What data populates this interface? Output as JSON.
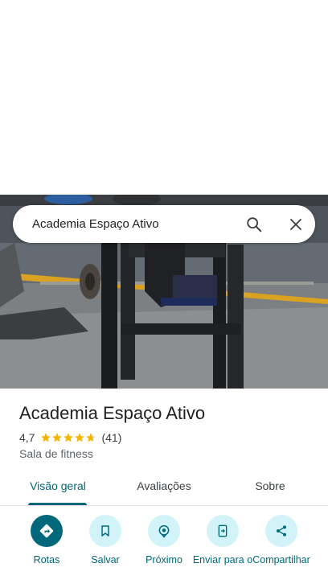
{
  "search": {
    "query": "Academia Espaço Ativo"
  },
  "place": {
    "title": "Academia Espaço Ativo",
    "rating": "4,7",
    "rating_value": 4.7,
    "review_count": "(41)",
    "category": "Sala de fitness"
  },
  "tabs": [
    {
      "label": "Visão geral",
      "active": true
    },
    {
      "label": "Avaliações",
      "active": false
    },
    {
      "label": "Sobre",
      "active": false
    }
  ],
  "actions": [
    {
      "label": "Rotas",
      "icon": "directions-icon"
    },
    {
      "label": "Salvar",
      "icon": "bookmark-icon"
    },
    {
      "label": "Próximo",
      "icon": "nearby-icon"
    },
    {
      "label": "Enviar para o",
      "icon": "send-to-phone-icon"
    },
    {
      "label": "Compartilhar",
      "icon": "share-icon"
    }
  ],
  "colors": {
    "accent": "#00687a",
    "action_bg": "#d2f4f9",
    "star": "#f4b400"
  }
}
